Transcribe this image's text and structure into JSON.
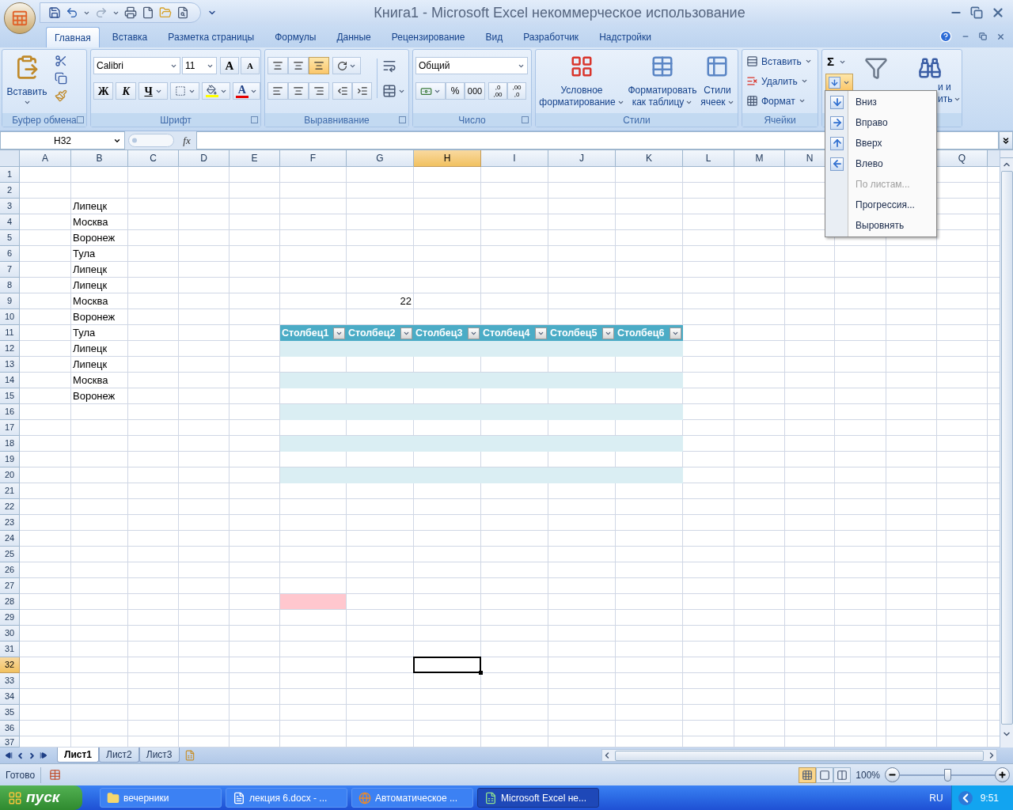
{
  "window": {
    "title": "Книга1 - Microsoft Excel некоммерческое использование"
  },
  "ribbon_tabs": [
    {
      "label": "Главная",
      "selected": true
    },
    {
      "label": "Вставка",
      "selected": false
    },
    {
      "label": "Разметка страницы",
      "selected": false
    },
    {
      "label": "Формулы",
      "selected": false
    },
    {
      "label": "Данные",
      "selected": false
    },
    {
      "label": "Рецензирование",
      "selected": false
    },
    {
      "label": "Вид",
      "selected": false
    },
    {
      "label": "Разработчик",
      "selected": false
    },
    {
      "label": "Надстройки",
      "selected": false
    }
  ],
  "ribbon": {
    "clipboard": {
      "paste": "Вставить",
      "label": "Буфер обмена"
    },
    "font": {
      "family": "Calibri",
      "size": "11",
      "grow": "A",
      "shrink": "A",
      "bold": "Ж",
      "italic": "К",
      "underline": "Ч",
      "font_color": "A",
      "label": "Шрифт"
    },
    "alignment": {
      "vertical_buttons": [
        {
          "selected": false
        },
        {
          "selected": false
        },
        {
          "selected": true
        }
      ],
      "label": "Выравнивание"
    },
    "number": {
      "format": "Общий",
      "percent": "%",
      "thousands": "000",
      "increase_decimal": {
        "top": ",0",
        "bottom": ",00"
      },
      "decrease_decimal": {
        "top": ",00",
        "bottom": ",0"
      },
      "label": "Число"
    },
    "styles": {
      "items": [
        {
          "line1": "Условное",
          "line2": "форматирование",
          "kind": "conditional"
        },
        {
          "line1": "Форматировать",
          "line2": "как таблицу",
          "kind": "table"
        },
        {
          "line1": "Стили",
          "line2": "ячеек",
          "kind": "cellstyle"
        }
      ],
      "label": "Стили"
    },
    "cells": {
      "items": [
        {
          "label": "Вставить",
          "kind": "insert"
        },
        {
          "label": "Удалить",
          "kind": "delete"
        },
        {
          "label": "Формат",
          "kind": "format"
        }
      ],
      "label": "Ячейки"
    },
    "editing": {
      "sum": "Σ",
      "fill_open": true,
      "find_partial": [
        "и и",
        "ить"
      ]
    }
  },
  "fill_menu": {
    "items": [
      {
        "label": "Вниз",
        "kind": "down",
        "disabled": false
      },
      {
        "label": "Вправо",
        "kind": "right",
        "disabled": false
      },
      {
        "label": "Вверх",
        "kind": "up",
        "disabled": false
      },
      {
        "label": "Влево",
        "kind": "left",
        "disabled": false
      },
      {
        "label": "По листам...",
        "kind": "plain",
        "disabled": true
      },
      {
        "label": "Прогрессия...",
        "kind": "plain",
        "disabled": false
      },
      {
        "label": "Выровнять",
        "kind": "plain",
        "disabled": false
      }
    ]
  },
  "formula_bar": {
    "name_box": "H32",
    "function_label": "fx"
  },
  "columns": [
    {
      "label": "A"
    },
    {
      "label": "B"
    },
    {
      "label": "C"
    },
    {
      "label": "D"
    },
    {
      "label": "E"
    },
    {
      "label": "F"
    },
    {
      "label": "G"
    },
    {
      "label": "H"
    },
    {
      "label": "I"
    },
    {
      "label": "J"
    },
    {
      "label": "K"
    },
    {
      "label": "L"
    },
    {
      "label": "M"
    },
    {
      "label": "N"
    },
    {},
    {},
    {
      "label": "Q"
    }
  ],
  "rows": [
    {
      "header": "1"
    },
    {
      "header": "2"
    },
    {
      "header": "3",
      "texts": {
        "B": "Липецк"
      }
    },
    {
      "header": "4",
      "texts": {
        "B": "Москва"
      }
    },
    {
      "header": "5",
      "texts": {
        "B": "Воронеж"
      }
    },
    {
      "header": "6",
      "texts": {
        "B": "Тула"
      }
    },
    {
      "header": "7",
      "texts": {
        "B": "Липецк"
      }
    },
    {
      "header": "8",
      "texts": {
        "B": "Липецк"
      }
    },
    {
      "header": "9",
      "texts": {
        "B": "Москва"
      },
      "numbers": {
        "G": "22"
      }
    },
    {
      "header": "10",
      "texts": {
        "B": "Воронеж"
      }
    },
    {
      "header": "11",
      "texts": {
        "B": "Тула"
      },
      "table_headers": {
        "F": "Столбец1",
        "G": "Столбец2",
        "H": "Столбец3",
        "I": "Столбец4",
        "J": "Столбец5",
        "K": "Столбец6"
      }
    },
    {
      "header": "12",
      "texts": {
        "B": "Липецк"
      },
      "table_band": true
    },
    {
      "header": "13",
      "texts": {
        "B": "Липецк"
      },
      "table_band": false
    },
    {
      "header": "14",
      "texts": {
        "B": "Москва"
      },
      "table_band": true
    },
    {
      "header": "15",
      "texts": {
        "B": "Воронеж"
      },
      "table_band": false
    },
    {
      "header": "16",
      "table_band": true
    },
    {
      "header": "17",
      "table_band": false
    },
    {
      "header": "18",
      "table_band": true
    },
    {
      "header": "19",
      "table_band": false
    },
    {
      "header": "20",
      "table_band": true
    },
    {
      "header": "21"
    },
    {
      "header": "22"
    },
    {
      "header": "23"
    },
    {
      "header": "24"
    },
    {
      "header": "25"
    },
    {
      "header": "26"
    },
    {
      "header": "27"
    },
    {
      "header": "28",
      "fills": {
        "F": {
          "color": "#ffc7ce"
        }
      }
    },
    {
      "header": "29"
    },
    {
      "header": "30"
    },
    {
      "header": "31"
    },
    {
      "header": "32"
    },
    {
      "header": "33"
    },
    {
      "header": "34"
    },
    {
      "header": "35"
    },
    {
      "header": "36"
    },
    {
      "header": "37"
    }
  ],
  "sheet_tabs": [
    {
      "label": "Лист1",
      "selected": true
    },
    {
      "label": "Лист2",
      "selected": false
    },
    {
      "label": "Лист3",
      "selected": false
    }
  ],
  "status_bar": {
    "text": "Готово",
    "view_buttons": [
      {
        "selected": true
      },
      {
        "selected": false
      },
      {
        "selected": false
      }
    ],
    "zoom": "100%",
    "zoom_slider": {
      "level": 0.5
    }
  },
  "taskbar": {
    "start": "пуск",
    "items": [
      {
        "label": "вечерники",
        "kind": "folder",
        "selected": false
      },
      {
        "label": "лекция 6.docx - ...",
        "kind": "word",
        "selected": false
      },
      {
        "label": "Автоматическое ...",
        "kind": "browser",
        "selected": false
      },
      {
        "label": "Microsoft Excel не...",
        "kind": "excel",
        "selected": true
      }
    ],
    "language": "RU",
    "clock": "9:51"
  }
}
